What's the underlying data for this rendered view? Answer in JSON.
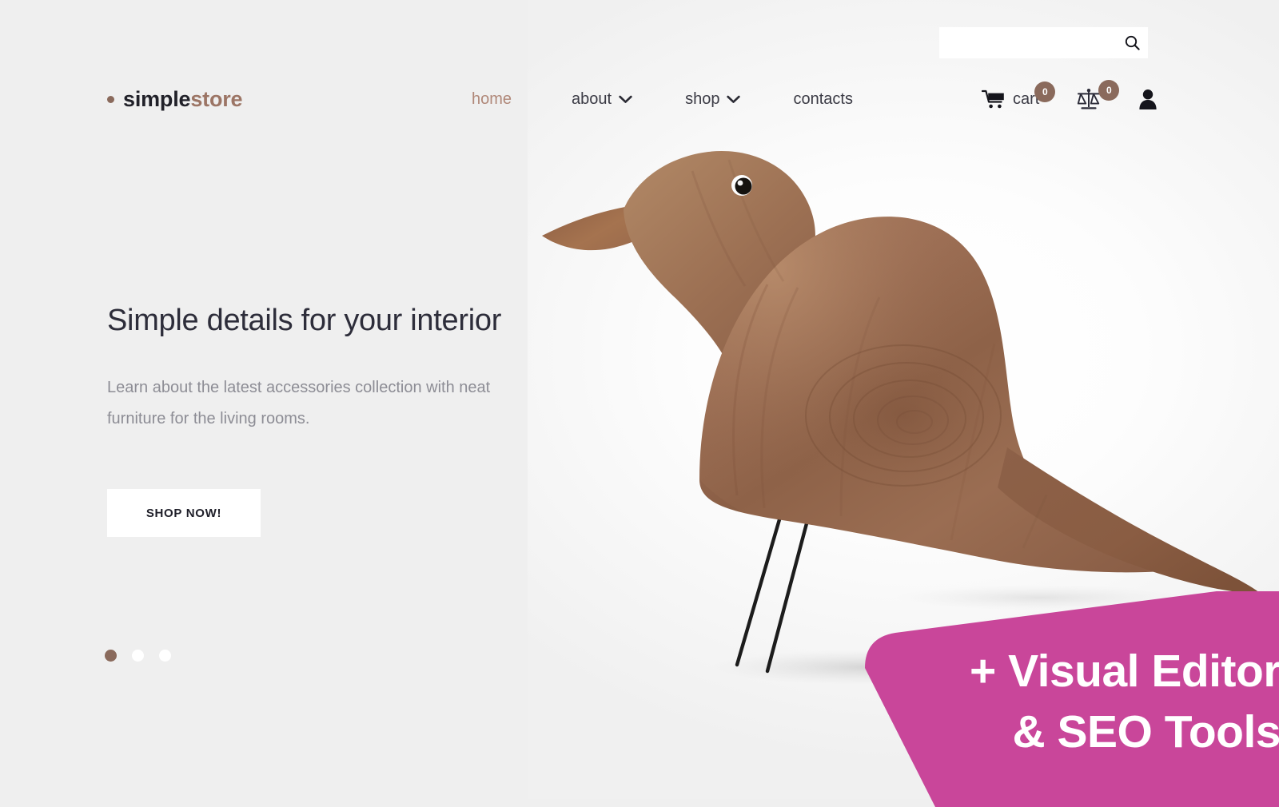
{
  "theme": {
    "background": "#efefef",
    "accent_brown": "#8a6a5c",
    "logo_brown": "#9c7565",
    "nav_active": "#b08879",
    "text_dark": "#2d2d3a",
    "text_muted": "#8d8d95",
    "promo_pink": "#c9469a"
  },
  "search": {
    "value": "",
    "placeholder": "",
    "icon": "search-icon"
  },
  "brand": {
    "dot": "bullet-dot",
    "name_first": "simple",
    "name_second": "store"
  },
  "nav": {
    "items": [
      {
        "label": "home",
        "active": true,
        "has_dropdown": false
      },
      {
        "label": "about",
        "active": false,
        "has_dropdown": true
      },
      {
        "label": "shop",
        "active": false,
        "has_dropdown": true
      },
      {
        "label": "contacts",
        "active": false,
        "has_dropdown": false
      }
    ]
  },
  "tools": {
    "cart": {
      "icon": "shopping-cart-icon",
      "label": "cart",
      "count": "0"
    },
    "compare": {
      "icon": "scales-compare-icon",
      "count": "0"
    },
    "account": {
      "icon": "user-account-icon"
    }
  },
  "hero": {
    "title": "Simple details for your interior",
    "subtitle": "Learn about the latest accessories collection with neat furniture for the living rooms.",
    "cta_label": "SHOP NOW!",
    "image_alt": "wooden-bird-sculpture"
  },
  "slider": {
    "dots": [
      {
        "active": true
      },
      {
        "active": false
      },
      {
        "active": false
      }
    ]
  },
  "promo": {
    "line1": "+ Visual Editor",
    "line2": "& SEO Tools"
  }
}
